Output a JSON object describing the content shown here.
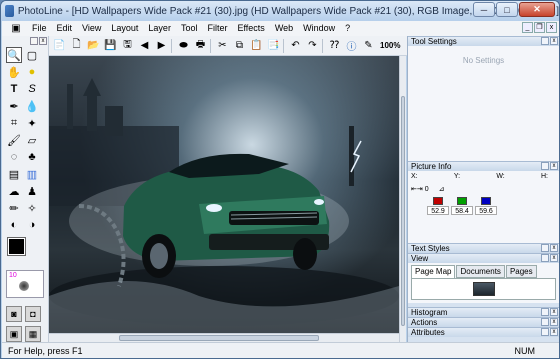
{
  "window": {
    "title": "PhotoLine - [HD Wallpapers Wide Pack #21 (30).jpg  (HD Wallpapers Wide Pack #21 (30), RGB Image, 1920x1200, 36%) ]",
    "minimize": "─",
    "maximize": "□",
    "close": "✕"
  },
  "menu": {
    "items": [
      "File",
      "Edit",
      "View",
      "Layout",
      "Layer",
      "Tool",
      "Filter",
      "Effects",
      "Web",
      "Window",
      "?"
    ]
  },
  "toolbar": {
    "zoom_label": "100%"
  },
  "panels": {
    "tool_settings": {
      "title": "Tool Settings",
      "empty_text": "No Settings"
    },
    "picture_info": {
      "title": "Picture Info",
      "coord_labels": [
        "X:",
        "Y:",
        "W:",
        "H:"
      ],
      "measure_value": "0",
      "channels": [
        {
          "color": "#c00000",
          "value": "52.9"
        },
        {
          "color": "#00a000",
          "value": "58.4"
        },
        {
          "color": "#0000c0",
          "value": "59.6"
        }
      ]
    },
    "text_styles": {
      "title": "Text Styles"
    },
    "view": {
      "title": "View",
      "tabs": [
        "Page Map",
        "Documents",
        "Pages"
      ]
    },
    "collapsed": [
      "Histogram",
      "Actions",
      "Attributes"
    ]
  },
  "brush": {
    "size": "10"
  },
  "status": {
    "help": "For Help, press F1",
    "num": "NUM"
  }
}
